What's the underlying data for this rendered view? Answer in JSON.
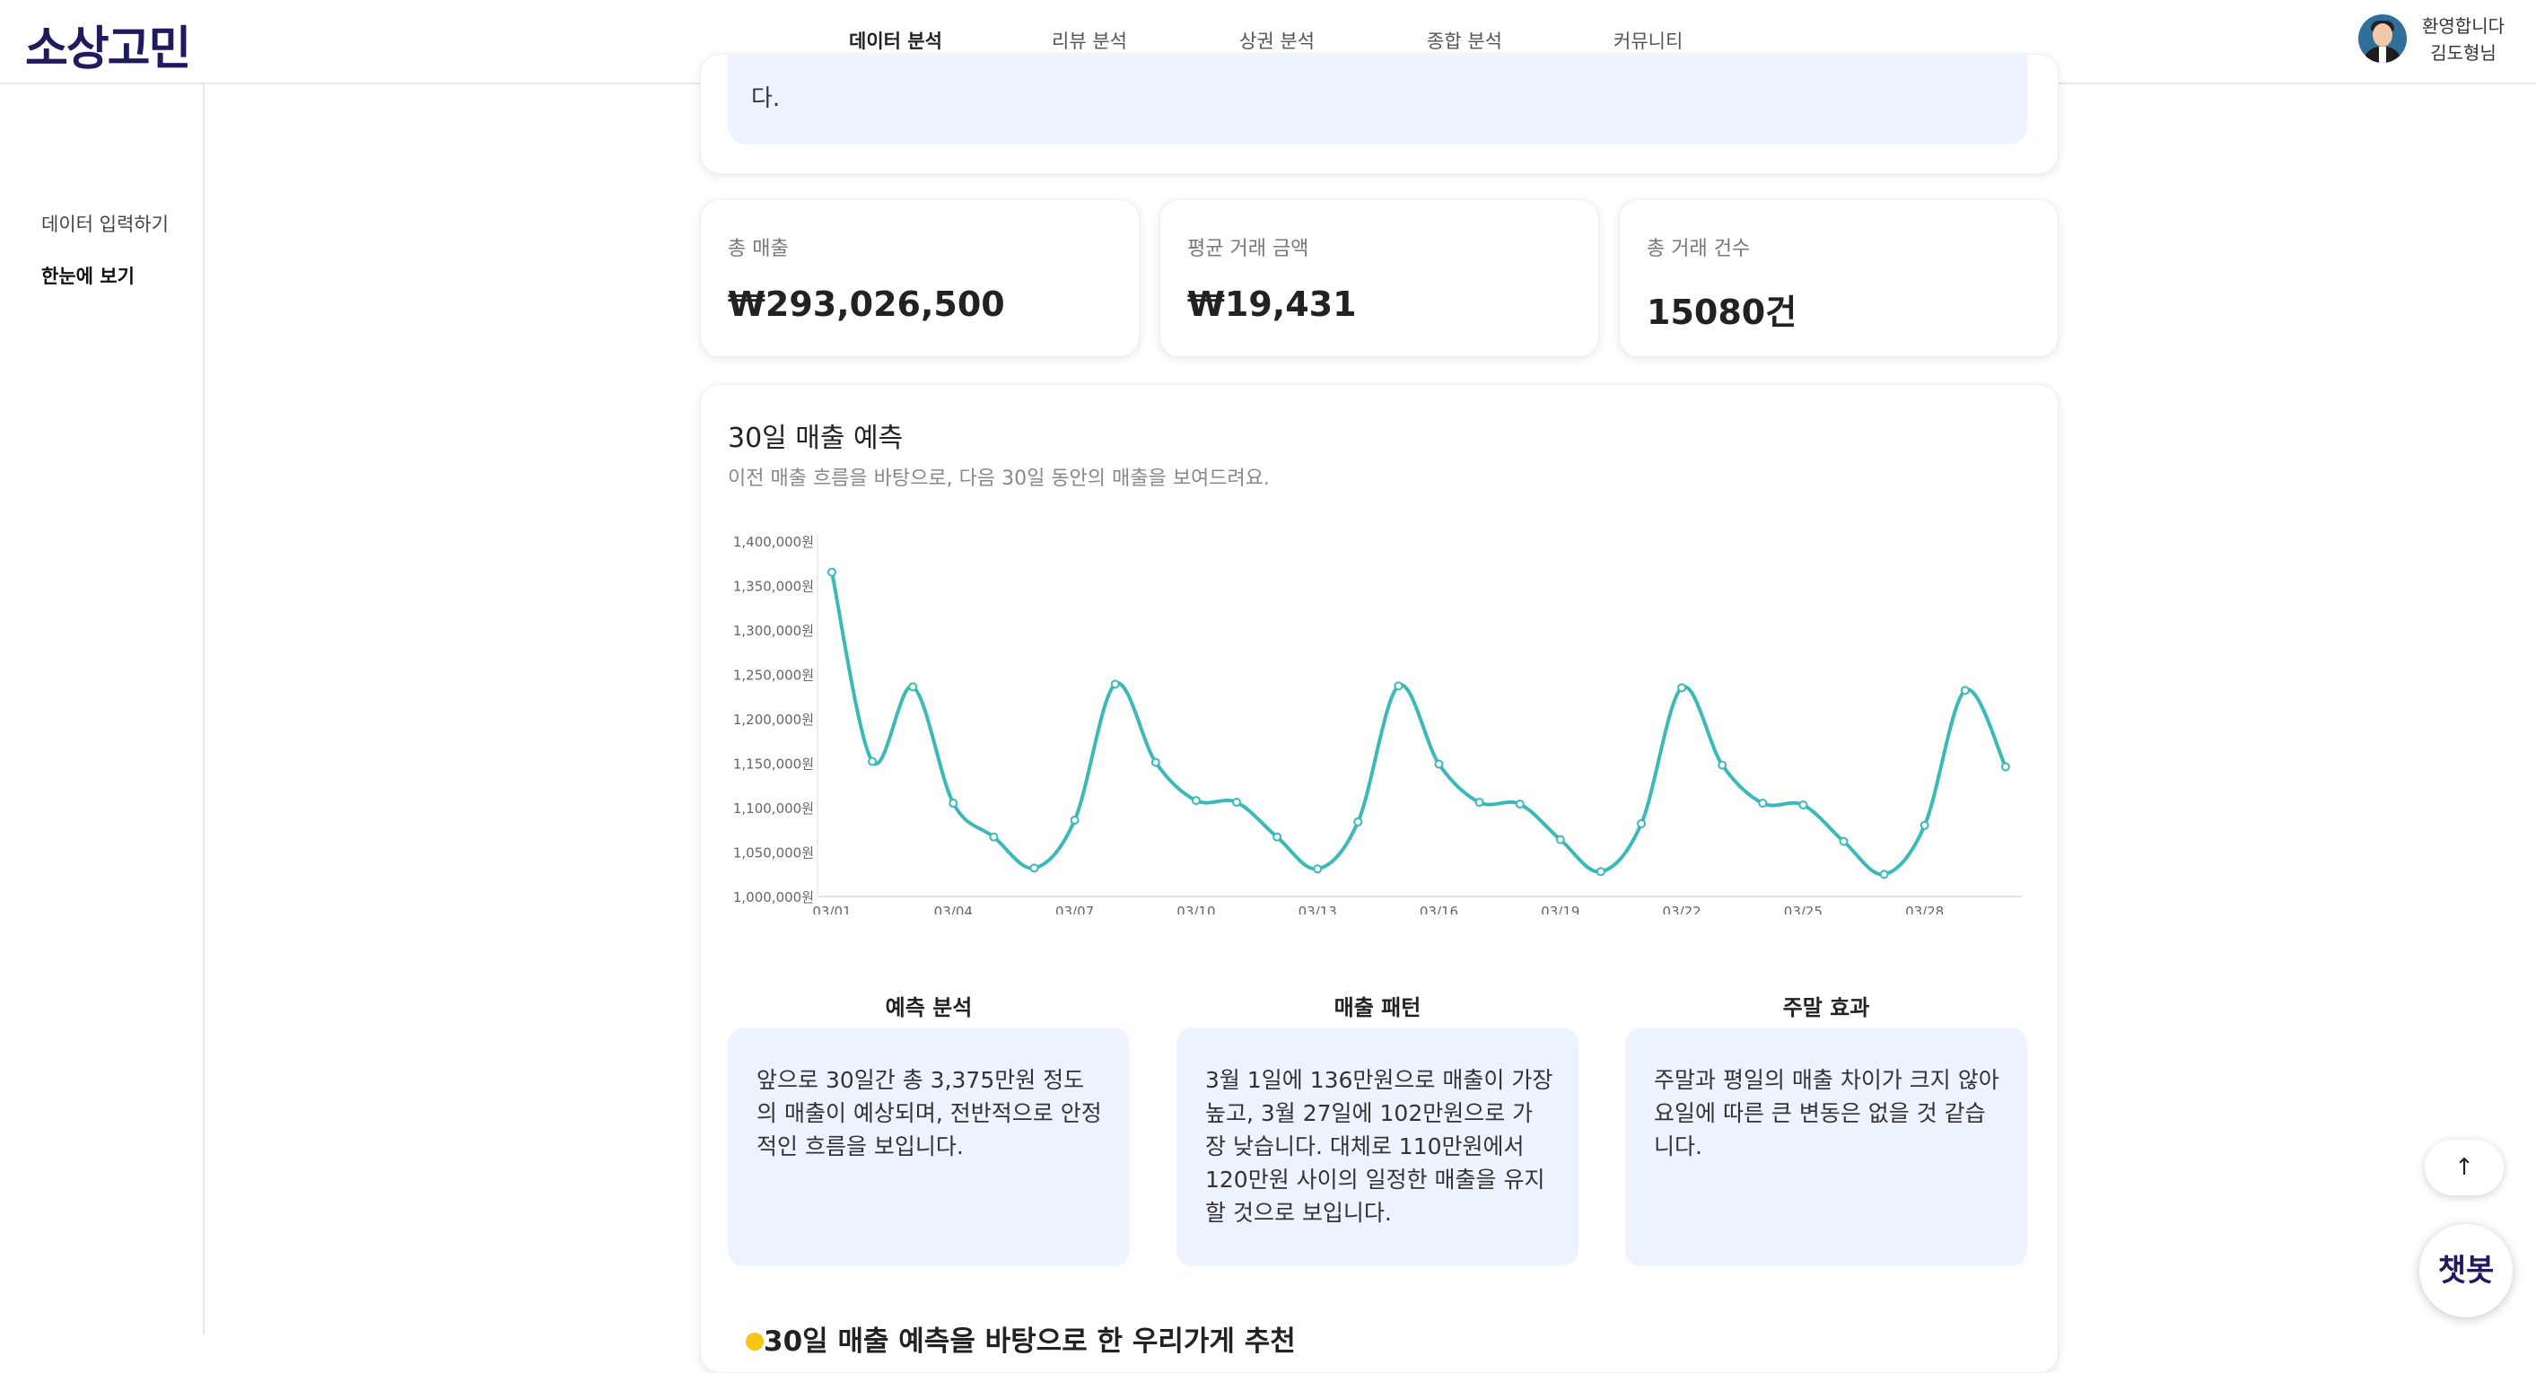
{
  "header": {
    "logo": "소상고민",
    "nav": [
      "데이터 분석",
      "리뷰 분석",
      "상권 분석",
      "종합 분석",
      "커뮤니티"
    ],
    "active_nav": "데이터 분석",
    "welcome_line1": "환영합니다",
    "welcome_line2": "김도형님"
  },
  "sidebar": {
    "items": [
      "데이터 입력하기",
      "한눈에 보기"
    ],
    "active": "한눈에 보기"
  },
  "top_note": {
    "text": "다."
  },
  "stats": [
    {
      "label": "총 매출",
      "value": "₩293,026,500"
    },
    {
      "label": "평균 거래 금액",
      "value": "₩19,431"
    },
    {
      "label": "총 거래 건수",
      "value": "15080건"
    }
  ],
  "forecast": {
    "title": "30일 매출 예측",
    "subtitle": "이전 매출 흐름을 바탕으로, 다음 30일 동안의 매출을 보여드려요."
  },
  "chart_data": {
    "type": "line",
    "title": "",
    "xlabel": "",
    "ylabel": "",
    "ylim": [
      1000000,
      1400000
    ],
    "y_ticks": [
      "1,000,000원",
      "1,050,000원",
      "1,100,000원",
      "1,150,000원",
      "1,200,000원",
      "1,250,000원",
      "1,300,000원",
      "1,350,000원",
      "1,400,000원"
    ],
    "x_tick_labels": [
      "03/01",
      "03/04",
      "03/07",
      "03/10",
      "03/13",
      "03/16",
      "03/19",
      "03/22",
      "03/25",
      "03/28"
    ],
    "x": [
      "03/01",
      "03/02",
      "03/03",
      "03/04",
      "03/05",
      "03/06",
      "03/07",
      "03/08",
      "03/09",
      "03/10",
      "03/11",
      "03/12",
      "03/13",
      "03/14",
      "03/15",
      "03/16",
      "03/17",
      "03/18",
      "03/19",
      "03/20",
      "03/21",
      "03/22",
      "03/23",
      "03/24",
      "03/25",
      "03/26",
      "03/27",
      "03/28",
      "03/29",
      "03/30"
    ],
    "series": [
      {
        "color": "#3bb9b9",
        "values": [
          1365000,
          1152000,
          1236000,
          1105000,
          1067000,
          1032000,
          1086000,
          1239000,
          1151000,
          1108000,
          1106000,
          1067000,
          1031000,
          1084000,
          1237000,
          1149000,
          1106000,
          1104000,
          1064000,
          1028000,
          1082000,
          1235000,
          1148000,
          1105000,
          1103000,
          1062000,
          1025000,
          1080000,
          1232000,
          1146000
        ]
      }
    ],
    "grid": false
  },
  "analysis": [
    {
      "title": "예측 분석",
      "text": "앞으로 30일간 총 3,375만원 정도의 매출이 예상되며, 전반적으로 안정적인 흐름을 보입니다."
    },
    {
      "title": "매출 패턴",
      "text": "3월 1일에 136만원으로 매출이 가장 높고, 3월 27일에 102만원으로 가장 낮습니다. 대체로 110만원에서 120만원 사이의 일정한 매출을 유지할 것으로 보입니다."
    },
    {
      "title": "주말 효과",
      "text": "주말과 평일의 매출 차이가 크지 않아 요일에 따른 큰 변동은 없을 것 같습니다."
    }
  ],
  "recommend_title": "30일 매출 예측을 바탕으로 한 우리가게 추천",
  "buttons": {
    "scroll_up": "↑",
    "chatbot": "챗봇"
  }
}
